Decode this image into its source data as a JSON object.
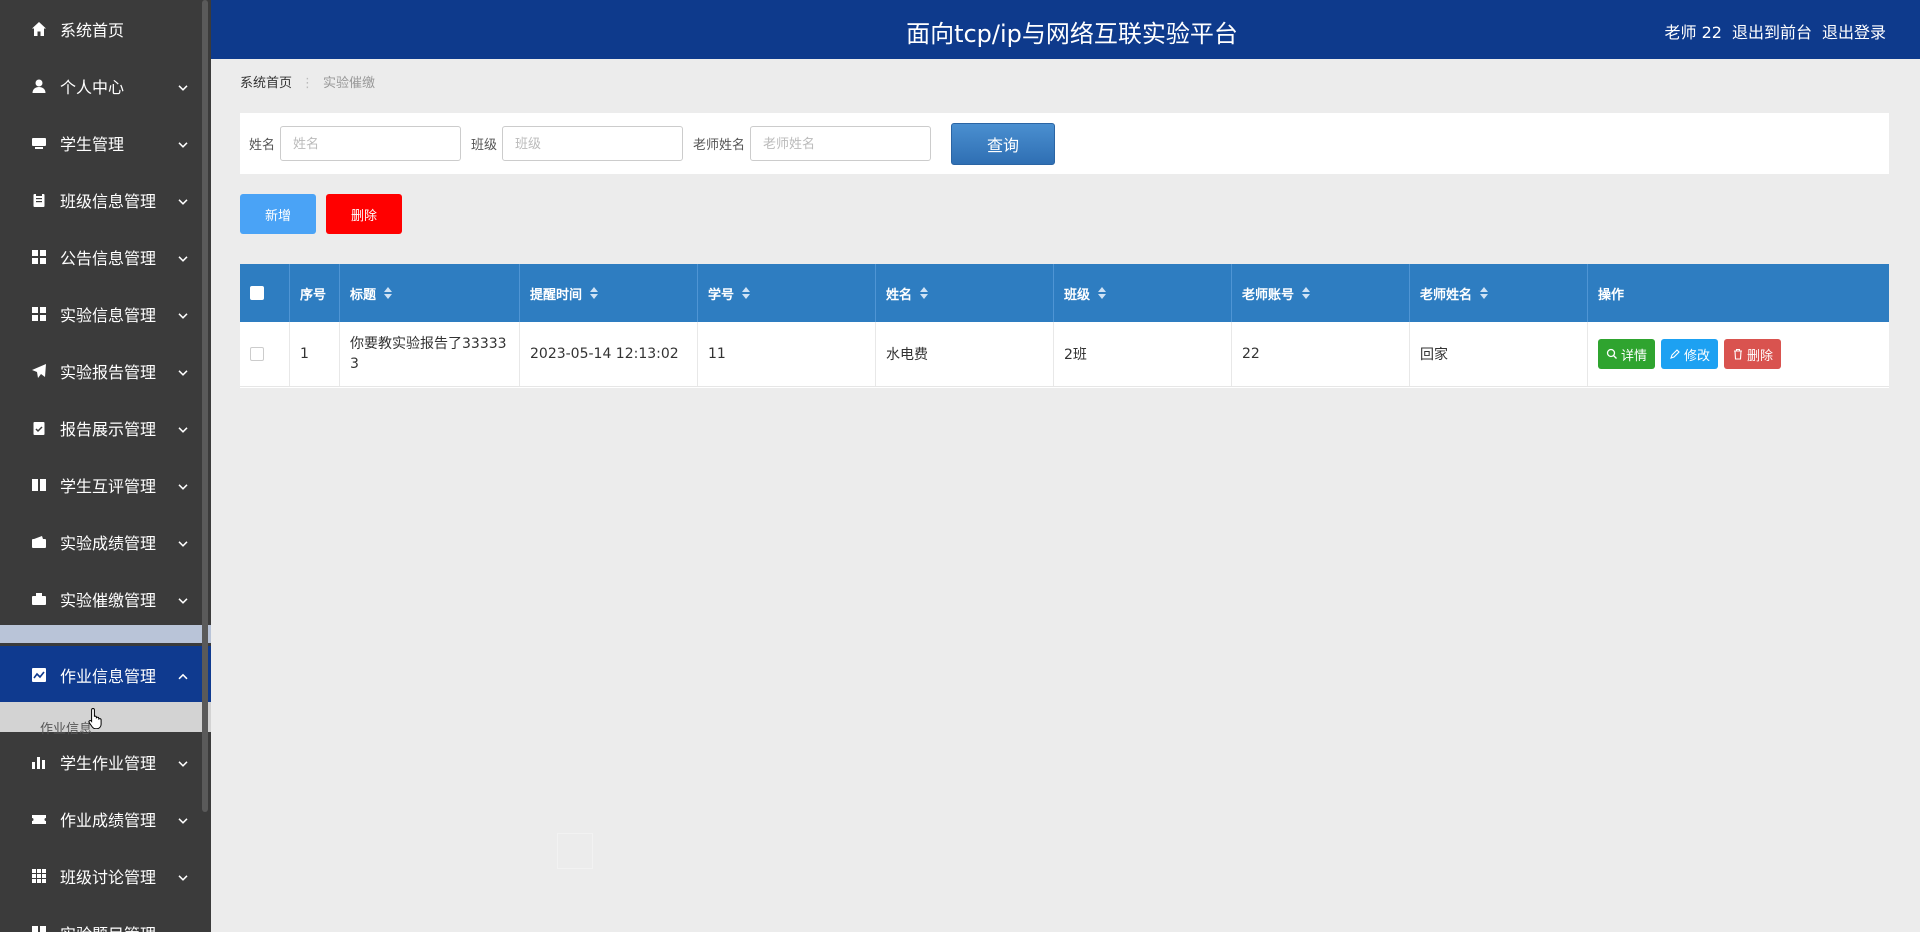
{
  "header": {
    "title": "面向tcp/ip与网络互联实验平台",
    "user": "老师 22",
    "to_front": "退出到前台",
    "logout": "退出登录"
  },
  "sidebar": {
    "items": [
      {
        "label": "系统首页",
        "icon": "home-icon"
      },
      {
        "label": "个人中心",
        "icon": "user-icon"
      },
      {
        "label": "学生管理",
        "icon": "tv-icon"
      },
      {
        "label": "班级信息管理",
        "icon": "clipboard-icon"
      },
      {
        "label": "公告信息管理",
        "icon": "grid-icon"
      },
      {
        "label": "实验信息管理",
        "icon": "grid-icon"
      },
      {
        "label": "实验报告管理",
        "icon": "send-icon"
      },
      {
        "label": "报告展示管理",
        "icon": "clipboard-check-icon"
      },
      {
        "label": "学生互评管理",
        "icon": "book-icon"
      },
      {
        "label": "实验成绩管理",
        "icon": "wallet-icon"
      },
      {
        "label": "实验催缴管理",
        "icon": "briefcase-icon"
      },
      {
        "label": "作业信息管理",
        "icon": "chart-icon"
      },
      {
        "label": "学生作业管理",
        "icon": "bar-chart-icon"
      },
      {
        "label": "作业成绩管理",
        "icon": "ticket-icon"
      },
      {
        "label": "班级讨论管理",
        "icon": "table-icon"
      },
      {
        "label": "实验题目管理",
        "icon": "grid-icon"
      }
    ],
    "submenu_label": "作业信息"
  },
  "breadcrumb": {
    "home": "系统首页",
    "current": "实验催缴"
  },
  "search": {
    "name_label": "姓名",
    "name_placeholder": "姓名",
    "class_label": "班级",
    "class_placeholder": "班级",
    "teacher_label": "老师姓名",
    "teacher_placeholder": "老师姓名",
    "query_label": "查询"
  },
  "actions": {
    "add": "新增",
    "delete": "删除"
  },
  "table": {
    "headers": [
      "序号",
      "标题",
      "提醒时间",
      "学号",
      "姓名",
      "班级",
      "老师账号",
      "老师姓名",
      "操作"
    ],
    "rows": [
      {
        "index": "1",
        "title": "你要教实验报告了333333",
        "remind_time": "2023-05-14 12:13:02",
        "student_no": "11",
        "name": "水电费",
        "class": "2班",
        "teacher_account": "22",
        "teacher_name": "回家"
      }
    ],
    "ops": {
      "detail": "详情",
      "edit": "修改",
      "delete": "删除"
    }
  },
  "colors": {
    "header": "#0e3a8c",
    "sidebar": "#3b3b3b",
    "table_header": "#2e7dc1",
    "active": "#0f3a8f"
  }
}
